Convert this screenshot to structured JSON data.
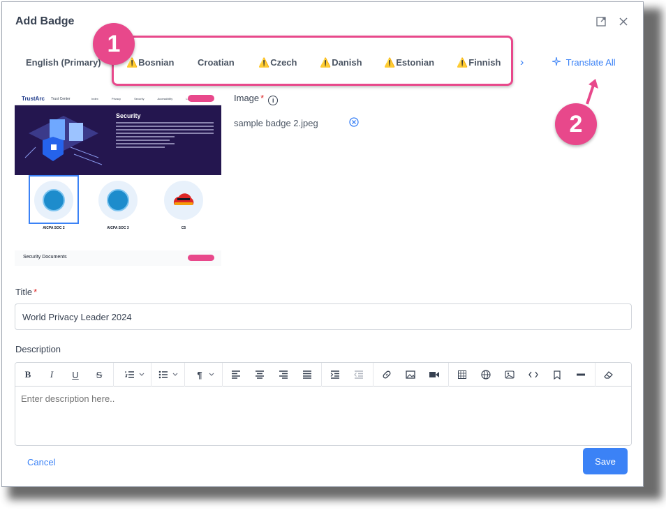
{
  "dialog": {
    "title": "Add Badge"
  },
  "tabs": [
    {
      "label": "English (Primary)",
      "warning": false
    },
    {
      "label": "Bosnian",
      "warning": true
    },
    {
      "label": "Croatian",
      "warning": false
    },
    {
      "label": "Czech",
      "warning": true
    },
    {
      "label": "Danish",
      "warning": true
    },
    {
      "label": "Estonian",
      "warning": true
    },
    {
      "label": "Finnish",
      "warning": true
    }
  ],
  "tabs_next_glyph": "›",
  "translate_all_label": "Translate All",
  "warning_glyph": "⚠️",
  "callouts": {
    "one": "1",
    "two": "2"
  },
  "image_field": {
    "label": "Image",
    "required_mark": "*",
    "file_name": "sample badge 2.jpeg"
  },
  "preview": {
    "logo": "TrustArc",
    "logo_sub": "Trust Center",
    "nav_links": "Index Privacy Security Accessibility Legal",
    "hero_title": "Security",
    "badges": [
      "AICPA SOC 2",
      "AICPA SOC 3",
      "C5"
    ],
    "footer_title": "Security Documents"
  },
  "title_field": {
    "label": "Title",
    "required_mark": "*",
    "value": "World Privacy Leader 2024"
  },
  "description_field": {
    "label": "Description",
    "placeholder": "Enter description here.."
  },
  "footer": {
    "cancel_label": "Cancel",
    "save_label": "Save"
  },
  "colors": {
    "accent": "#3b82f6",
    "highlight": "#e8488b",
    "warning": "#f59e0b"
  }
}
